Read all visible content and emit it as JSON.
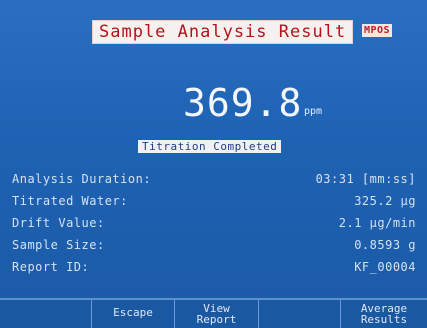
{
  "header": {
    "title": "Sample Analysis Result",
    "badge": "MPOS"
  },
  "result": {
    "value": "369.8",
    "unit": "ppm",
    "status": "Titration Completed"
  },
  "details": [
    {
      "label": "Analysis Duration:",
      "value": "03:31 [mm:ss]"
    },
    {
      "label": "Titrated Water:",
      "value": "325.2 µg"
    },
    {
      "label": "Drift Value:",
      "value": "2.1 µg/min"
    },
    {
      "label": "Sample Size:",
      "value": "0.8593 g"
    },
    {
      "label": "Report ID:",
      "value": "KF_00004"
    }
  ],
  "softkeys": [
    {
      "label": ""
    },
    {
      "label": "Escape"
    },
    {
      "label": "View\nReport"
    },
    {
      "label": ""
    },
    {
      "label": "Average\nResults"
    }
  ]
}
